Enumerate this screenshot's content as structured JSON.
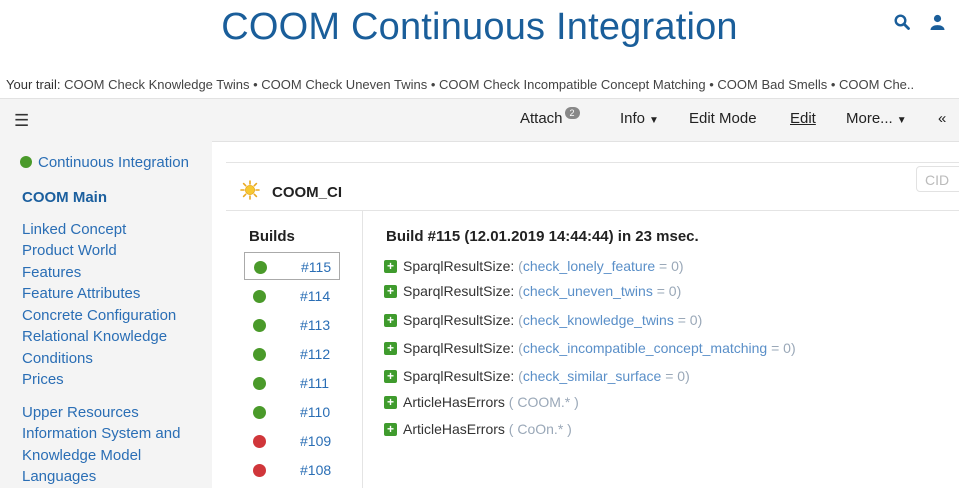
{
  "header": {
    "title": "COOM Continuous Integration",
    "icons": [
      "search-icon",
      "user-icon"
    ]
  },
  "trail": {
    "label": "Your trail:",
    "items": [
      "COOM Check Knowledge Twins",
      "COOM Check Uneven Twins",
      "COOM Check Incompatible Concept Matching",
      "COOM Bad Smells",
      "COOM Che.."
    ]
  },
  "toolbar": {
    "attach": "Attach",
    "attach_count": "2",
    "info": "Info",
    "edit_mode": "Edit Mode",
    "edit": "Edit",
    "more": "More...",
    "collapse": "«"
  },
  "sidebar": {
    "ci": "Continuous Integration",
    "main": "COOM Main",
    "group1": [
      "Linked Concept",
      "Product World",
      "Features",
      "Feature Attributes",
      "Concrete Configuration",
      "Relational Knowledge",
      "Conditions",
      "Prices"
    ],
    "group2": [
      "Upper Resources",
      "Information System and",
      "Knowledge Model",
      "Languages"
    ]
  },
  "content": {
    "cid_placeholder": "CID",
    "widget_title": "COOM_CI",
    "builds_title": "Builds",
    "builds": [
      {
        "num": "#115",
        "status": "green"
      },
      {
        "num": "#114",
        "status": "green"
      },
      {
        "num": "#113",
        "status": "green"
      },
      {
        "num": "#112",
        "status": "green"
      },
      {
        "num": "#111",
        "status": "green"
      },
      {
        "num": "#110",
        "status": "green"
      },
      {
        "num": "#109",
        "status": "red"
      },
      {
        "num": "#108",
        "status": "red"
      }
    ],
    "build_info": "Build #115 (12.01.2019 14:44:44) in 23 msec.",
    "results": [
      {
        "label": "SparqlResultSize:",
        "link": "check_lonely_feature",
        "value": "= 0"
      },
      {
        "label": "SparqlResultSize:",
        "link": "check_uneven_twins",
        "value": "= 0"
      },
      {
        "label": "SparqlResultSize:",
        "link": "check_knowledge_twins",
        "value": "= 0"
      },
      {
        "label": "SparqlResultSize:",
        "link": "check_incompatible_concept_matching",
        "value": "= 0"
      },
      {
        "label": "SparqlResultSize:",
        "link": "check_similar_surface",
        "value": "= 0"
      },
      {
        "label": "ArticleHasErrors",
        "arg": "COOM.*"
      },
      {
        "label": "ArticleHasErrors",
        "arg": "CoOn.*"
      }
    ]
  },
  "colors": {
    "green": "#4a9a2a",
    "red": "#d0363a",
    "link": "#2a6eb5",
    "title": "#1a5e9a"
  }
}
